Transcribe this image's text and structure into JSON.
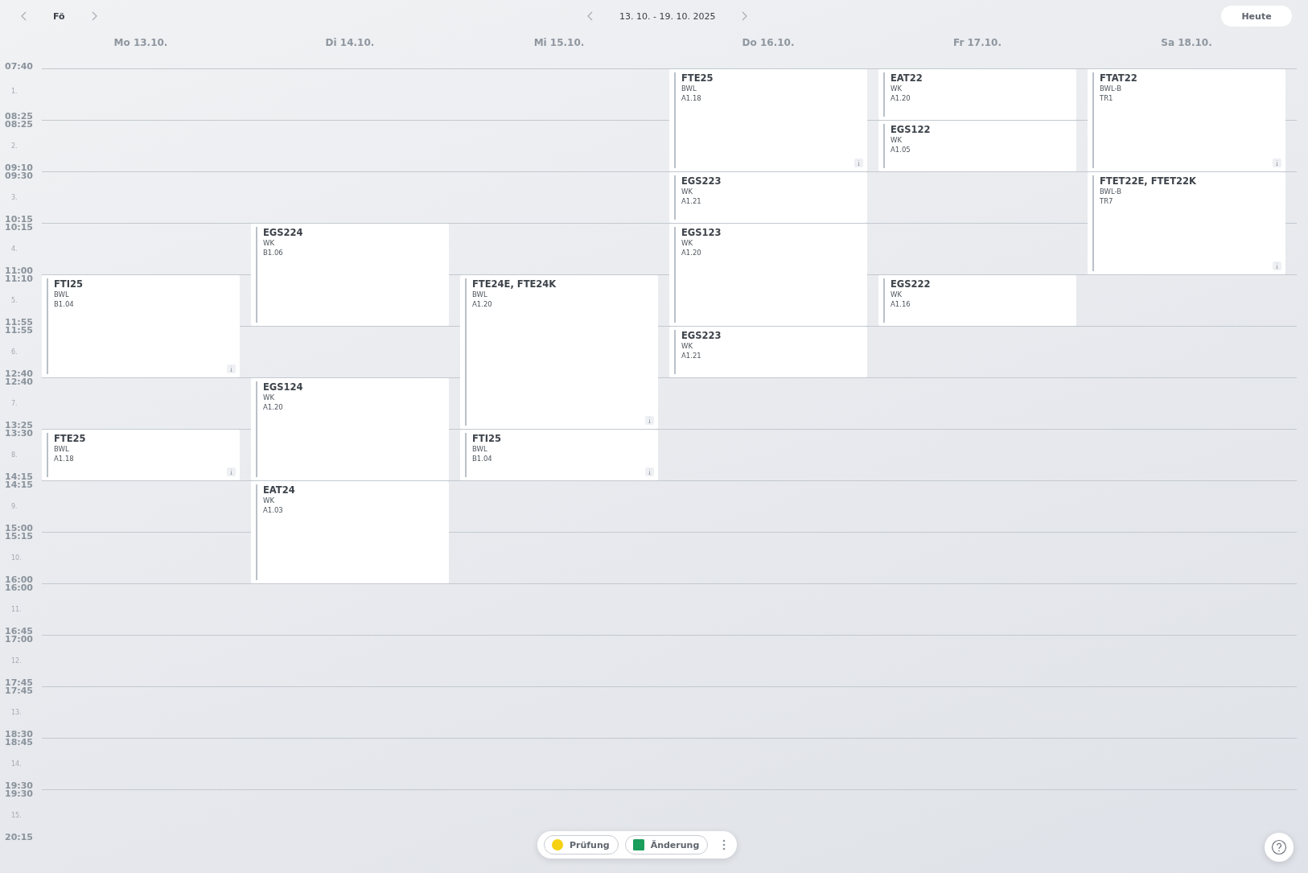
{
  "toolbar": {
    "class_label": "Fö",
    "week_label": "13. 10. - 19. 10. 2025",
    "today_button": "Heute"
  },
  "periods": [
    {
      "number": "1.",
      "start": "07:40",
      "end": "08:25"
    },
    {
      "number": "2.",
      "start": "08:25",
      "end": "09:10"
    },
    {
      "number": "3.",
      "start": "09:30",
      "end": "10:15"
    },
    {
      "number": "4.",
      "start": "10:15",
      "end": "11:00"
    },
    {
      "number": "5.",
      "start": "11:10",
      "end": "11:55"
    },
    {
      "number": "6.",
      "start": "11:55",
      "end": "12:40"
    },
    {
      "number": "7.",
      "start": "12:40",
      "end": "13:25"
    },
    {
      "number": "8.",
      "start": "13:30",
      "end": "14:15"
    },
    {
      "number": "9.",
      "start": "14:15",
      "end": "15:00"
    },
    {
      "number": "10.",
      "start": "15:15",
      "end": "16:00"
    },
    {
      "number": "11.",
      "start": "16:00",
      "end": "16:45"
    },
    {
      "number": "12.",
      "start": "17:00",
      "end": "17:45"
    },
    {
      "number": "13.",
      "start": "17:45",
      "end": "18:30"
    },
    {
      "number": "14.",
      "start": "18:45",
      "end": "19:30"
    },
    {
      "number": "15.",
      "start": "19:30",
      "end": "20:15"
    }
  ],
  "days": [
    {
      "label": "Mo 13.10.",
      "slots": [
        {
          "kind": "free"
        },
        {
          "kind": "free"
        },
        {
          "kind": "free"
        },
        {
          "kind": "free"
        },
        {
          "kind": "lesson",
          "class": "FTI25",
          "subject": "BWL",
          "room": "B1.04",
          "info": true
        },
        {
          "kind": "continued"
        },
        {
          "kind": "free"
        },
        {
          "kind": "lesson",
          "class": "FTE25",
          "subject": "BWL",
          "room": "A1.18",
          "info": true
        }
      ]
    },
    {
      "label": "Di 14.10.",
      "slots": [
        {
          "kind": "free"
        },
        {
          "kind": "free"
        },
        {
          "kind": "free"
        },
        {
          "kind": "lesson",
          "class": "EGS224",
          "subject": "WK",
          "room": "B1.06",
          "info": false
        },
        {
          "kind": "continued"
        },
        {
          "kind": "free"
        },
        {
          "kind": "lesson",
          "class": "EGS124",
          "subject": "WK",
          "room": "A1.20",
          "info": false
        },
        {
          "kind": "continued"
        },
        {
          "kind": "lesson",
          "class": "EAT24",
          "subject": "WK",
          "room": "A1.03",
          "info": false
        },
        {
          "kind": "continued"
        }
      ]
    },
    {
      "label": "Mi 15.10.",
      "slots": [
        {
          "kind": "free"
        },
        {
          "kind": "free"
        },
        {
          "kind": "free"
        },
        {
          "kind": "free"
        },
        {
          "kind": "lesson",
          "class": "FTE24E, FTE24K",
          "subject": "BWL",
          "room": "A1.20",
          "info": true
        },
        {
          "kind": "continued"
        },
        {
          "kind": "continued"
        },
        {
          "kind": "lesson",
          "class": "FTI25",
          "subject": "BWL",
          "room": "B1.04",
          "info": true
        }
      ]
    },
    {
      "label": "Do 16.10.",
      "slots": [
        {
          "kind": "lesson",
          "class": "FTE25",
          "subject": "BWL",
          "room": "A1.18",
          "info": true
        },
        {
          "kind": "continued"
        },
        {
          "kind": "lesson",
          "class": "EGS223",
          "subject": "WK",
          "room": "A1.21",
          "info": false
        },
        {
          "kind": "lesson",
          "class": "EGS123",
          "subject": "WK",
          "room": "A1.20",
          "info": false
        },
        {
          "kind": "continued"
        },
        {
          "kind": "lesson",
          "class": "EGS223",
          "subject": "WK",
          "room": "A1.21",
          "info": false
        }
      ]
    },
    {
      "label": "Fr 17.10.",
      "slots": [
        {
          "kind": "lesson",
          "class": "EAT22",
          "subject": "WK",
          "room": "A1.20",
          "info": false
        },
        {
          "kind": "lesson",
          "class": "EGS122",
          "subject": "WK",
          "room": "A1.05",
          "info": false
        },
        {
          "kind": "free"
        },
        {
          "kind": "free"
        },
        {
          "kind": "lesson",
          "class": "EGS222",
          "subject": "WK",
          "room": "A1.16",
          "info": false
        }
      ]
    },
    {
      "label": "Sa 18.10.",
      "slots": [
        {
          "kind": "lesson",
          "class": "FTAT22",
          "subject": "BWL-B",
          "room": "TR1",
          "info": true
        },
        {
          "kind": "continued"
        },
        {
          "kind": "lesson",
          "class": "FTET22E, FTET22K",
          "subject": "BWL-B",
          "room": "TR7",
          "info": true
        },
        {
          "kind": "continued"
        }
      ]
    }
  ],
  "legend": [
    {
      "kind": "dot",
      "label": "Prüfung",
      "color": "#f5d10f"
    },
    {
      "kind": "square",
      "label": "Änderung",
      "color": "#1a9e5c"
    }
  ]
}
